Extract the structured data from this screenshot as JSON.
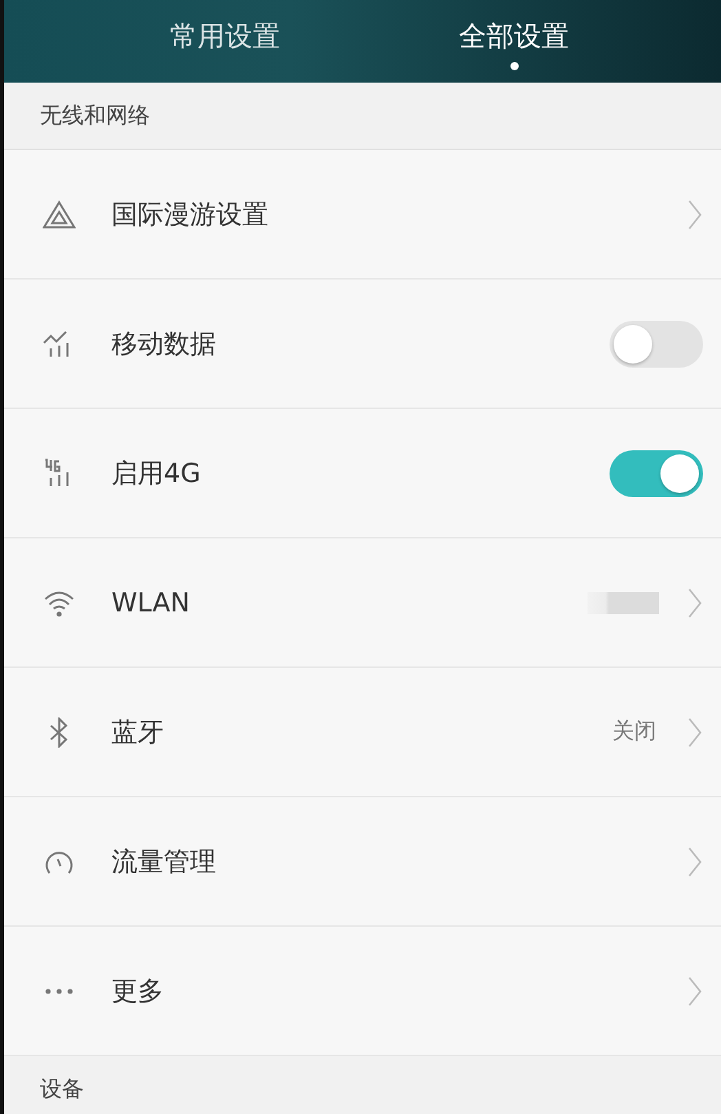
{
  "tabs": [
    {
      "label": "常用设置",
      "selected": false
    },
    {
      "label": "全部设置",
      "selected": true
    }
  ],
  "sections": [
    {
      "title": "无线和网络",
      "items": [
        {
          "label": "国际漫游设置",
          "kind": "chevron"
        },
        {
          "label": "移动数据",
          "kind": "switch",
          "on": false
        },
        {
          "label": "启用4G",
          "kind": "switch",
          "on": true
        },
        {
          "label": "WLAN",
          "kind": "chevron",
          "redacted": true
        },
        {
          "label": "蓝牙",
          "kind": "chevron",
          "value": "关闭"
        },
        {
          "label": "流量管理",
          "kind": "chevron"
        },
        {
          "label": "更多",
          "kind": "chevron"
        }
      ]
    },
    {
      "title": "设备"
    }
  ]
}
